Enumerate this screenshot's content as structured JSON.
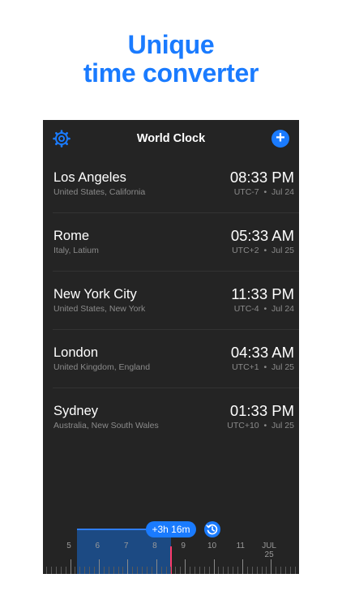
{
  "headline": {
    "line1": "Unique",
    "line2": "time converter"
  },
  "navbar": {
    "title": "World Clock"
  },
  "clocks": [
    {
      "city": "Los Angeles",
      "region": "United States, California",
      "time": "08:33 PM",
      "offset": "UTC-7  •  Jul 24"
    },
    {
      "city": "Rome",
      "region": "Italy, Latium",
      "time": "05:33 AM",
      "offset": "UTC+2  •  Jul 25"
    },
    {
      "city": "New York City",
      "region": "United States, New York",
      "time": "11:33 PM",
      "offset": "UTC-4  •  Jul 24"
    },
    {
      "city": "London",
      "region": "United Kingdom, England",
      "time": "04:33 AM",
      "offset": "UTC+1  •  Jul 25"
    },
    {
      "city": "Sydney",
      "region": "Australia, New South Wales",
      "time": "01:33 PM",
      "offset": "UTC+10  •  Jul 25"
    }
  ],
  "scrubber": {
    "shift": "+3h 16m",
    "hours": [
      "5",
      "6",
      "7",
      "8",
      "9",
      "10",
      "11",
      "JUL 25"
    ]
  },
  "colors": {
    "accent": "#1a7bff",
    "background": "#242424",
    "now_marker": "#ff3b6b"
  }
}
